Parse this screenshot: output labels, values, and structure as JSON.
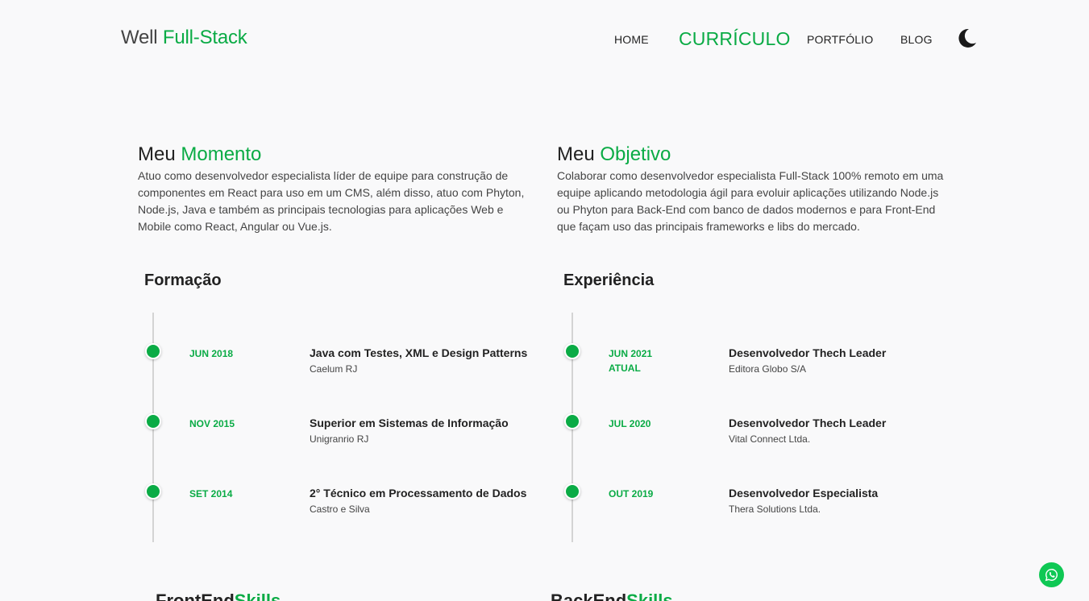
{
  "header": {
    "brand_prefix": "Well",
    "brand_accent": "Full-Stack",
    "nav": [
      {
        "label": "HOME",
        "active": false
      },
      {
        "label": "CURRÍCULO",
        "active": true
      },
      {
        "label": "PORTFÓLIO",
        "active": false
      },
      {
        "label": "BLOG",
        "active": false
      }
    ],
    "theme_icon": "moon-icon"
  },
  "moment": {
    "title_prefix": "Meu",
    "title_accent": "Momento",
    "text": "Atuo como desenvolvedor especialista líder de equipe para construção de componentes em React para uso em um CMS, além disso, atuo com Phyton, Node.js, Java e também as principais tecnologias para aplicações Web e Mobile como React, Angular ou Vue.js."
  },
  "objective": {
    "title_prefix": "Meu",
    "title_accent": "Objetivo",
    "text": "Colaborar como desenvolvedor especialista Full-Stack 100% remoto em uma equipe aplicando metodologia ágil para evoluir aplicações utilizando Node.js ou Phyton para Back-End com banco de dados modernos e para Front-End que façam uso das principais frameworks e libs do mercado."
  },
  "education": {
    "title": "Formação",
    "items": [
      {
        "date": "JUN 2018",
        "date2": "",
        "title": "Java com Testes, XML e Design Patterns",
        "subtitle": "Caelum RJ"
      },
      {
        "date": "NOV 2015",
        "date2": "",
        "title": "Superior em Sistemas de Informação",
        "subtitle": "Unigranrio RJ"
      },
      {
        "date": "SET 2014",
        "date2": "",
        "title": "2° Técnico em Processamento de Dados",
        "subtitle": "Castro e Silva"
      }
    ]
  },
  "experience": {
    "title": "Experiência",
    "items": [
      {
        "date": "JUN 2021",
        "date2": "ATUAL",
        "title": "Desenvolvedor Thech Leader",
        "subtitle": "Editora Globo S/A"
      },
      {
        "date": "JUL 2020",
        "date2": "",
        "title": "Desenvolvedor Thech Leader",
        "subtitle": "Vital Connect Ltda."
      },
      {
        "date": "OUT 2019",
        "date2": "",
        "title": "Desenvolvedor Especialista",
        "subtitle": "Thera Solutions Ltda."
      }
    ]
  },
  "skills": {
    "frontend_prefix": "FrontEnd",
    "backend_prefix": "BackEnd",
    "accent": "Skills"
  },
  "colors": {
    "accent": "#0aab45",
    "background": "#f9f9fa",
    "whatsapp": "#0fc854"
  },
  "whatsapp_icon": "whatsapp-icon"
}
